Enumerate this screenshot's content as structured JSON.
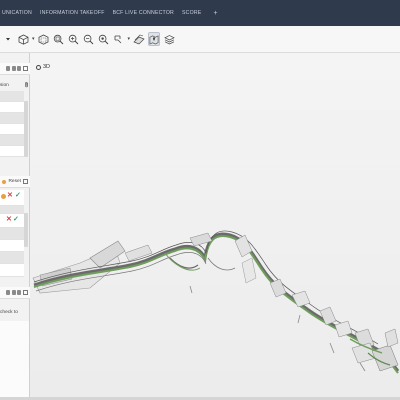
{
  "nav": {
    "tabs": [
      "UNICATION",
      "INFORMATION TAKEOFF",
      "BCF LIVE CONNECTOR",
      "SCORE"
    ],
    "add_label": "+"
  },
  "toolbar": {
    "icons": [
      "dropdown-arrow-icon",
      "cube-view-icon",
      "box-select-icon",
      "zoom-fit-icon",
      "zoom-in-icon",
      "zoom-out-icon",
      "zoom-window-icon",
      "pan-icon",
      "section-icon",
      "pencil-markup-icon",
      "map-pin-icon",
      "layers-icon"
    ],
    "caret": "▾"
  },
  "left_panel": {
    "panel1": {
      "header_text": "sion",
      "link_icon": "paperclip-icon"
    },
    "panel2": {
      "reset_label": "Reset"
    },
    "panel3": {
      "text": "check to"
    }
  },
  "viewport": {
    "view_label": "3D"
  },
  "colors": {
    "nav_bg": "#2f3a4d",
    "toolbar_bg": "#f7f7f7",
    "viewport_bg": "#efefef",
    "model_green": "#6f9e5c",
    "reject": "#d93a3a",
    "accept": "#2ea36a"
  }
}
